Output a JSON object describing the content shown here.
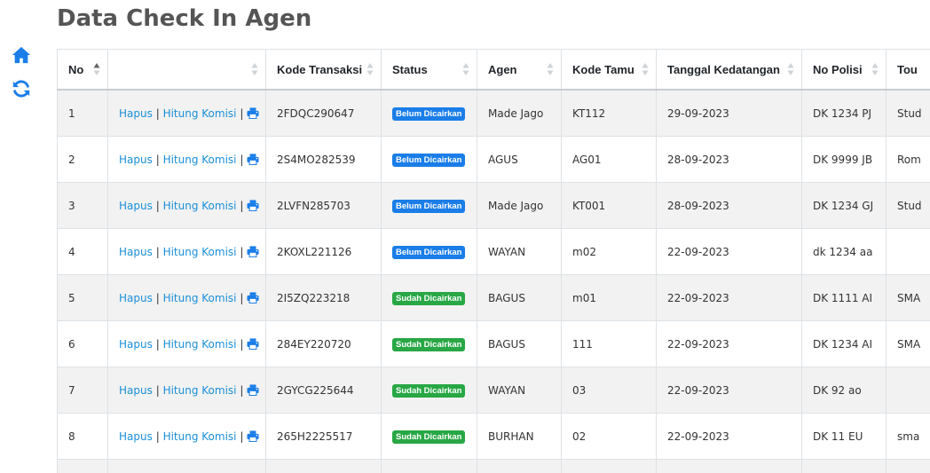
{
  "page": {
    "title": "Data Check In Agen"
  },
  "sidebar": {
    "icons": [
      {
        "name": "home-icon"
      },
      {
        "name": "refresh-icon"
      }
    ]
  },
  "colors": {
    "badge_unpaid": "#1a7de8",
    "badge_paid": "#28a745",
    "link": "#1a8fd8",
    "icon": "#1a7de8"
  },
  "table": {
    "columns": [
      {
        "label": "No",
        "sorted": "asc"
      },
      {
        "label": "",
        "sorted": "none"
      },
      {
        "label": "Kode Transaksi",
        "sorted": "none"
      },
      {
        "label": "Status",
        "sorted": "none"
      },
      {
        "label": "Agen",
        "sorted": "none"
      },
      {
        "label": "Kode Tamu",
        "sorted": "none"
      },
      {
        "label": "Tanggal Kedatangan",
        "sorted": "none"
      },
      {
        "label": "No Polisi",
        "sorted": "none"
      },
      {
        "label": "Tou",
        "sorted": "none"
      }
    ],
    "actions": {
      "delete": "Hapus",
      "separator": "|",
      "commission": "Hitung Komisi",
      "print_icon": "print-icon"
    },
    "rows": [
      {
        "no": "1",
        "kode_transaksi": "2FDQC290647",
        "status": "Belum Dicairkan",
        "status_type": "unpaid",
        "agen": "Made Jago",
        "kode_tamu": "KT112",
        "tanggal": "29-09-2023",
        "no_polisi": "DK 1234 PJ",
        "tour": "Stud"
      },
      {
        "no": "2",
        "kode_transaksi": "2S4MO282539",
        "status": "Belum Dicairkan",
        "status_type": "unpaid",
        "agen": "AGUS",
        "kode_tamu": "AG01",
        "tanggal": "28-09-2023",
        "no_polisi": "DK 9999 JB",
        "tour": "Rom"
      },
      {
        "no": "3",
        "kode_transaksi": "2LVFN285703",
        "status": "Belum Dicairkan",
        "status_type": "unpaid",
        "agen": "Made Jago",
        "kode_tamu": "KT001",
        "tanggal": "28-09-2023",
        "no_polisi": "DK 1234 GJ",
        "tour": "Stud"
      },
      {
        "no": "4",
        "kode_transaksi": "2KOXL221126",
        "status": "Belum Dicairkan",
        "status_type": "unpaid",
        "agen": "WAYAN",
        "kode_tamu": "m02",
        "tanggal": "22-09-2023",
        "no_polisi": "dk 1234 aa",
        "tour": ""
      },
      {
        "no": "5",
        "kode_transaksi": "2I5ZQ223218",
        "status": "Sudah Dicairkan",
        "status_type": "paid",
        "agen": "BAGUS",
        "kode_tamu": "m01",
        "tanggal": "22-09-2023",
        "no_polisi": "DK 1111 AI",
        "tour": "SMA"
      },
      {
        "no": "6",
        "kode_transaksi": "284EY220720",
        "status": "Sudah Dicairkan",
        "status_type": "paid",
        "agen": "BAGUS",
        "kode_tamu": "111",
        "tanggal": "22-09-2023",
        "no_polisi": "DK 1234 AI",
        "tour": "SMA"
      },
      {
        "no": "7",
        "kode_transaksi": "2GYCG225644",
        "status": "Sudah Dicairkan",
        "status_type": "paid",
        "agen": "WAYAN",
        "kode_tamu": "03",
        "tanggal": "22-09-2023",
        "no_polisi": "DK 92 ao",
        "tour": ""
      },
      {
        "no": "8",
        "kode_transaksi": "265H2225517",
        "status": "Sudah Dicairkan",
        "status_type": "paid",
        "agen": "BURHAN",
        "kode_tamu": "02",
        "tanggal": "22-09-2023",
        "no_polisi": "DK 11 EU",
        "tour": "sma"
      }
    ]
  }
}
